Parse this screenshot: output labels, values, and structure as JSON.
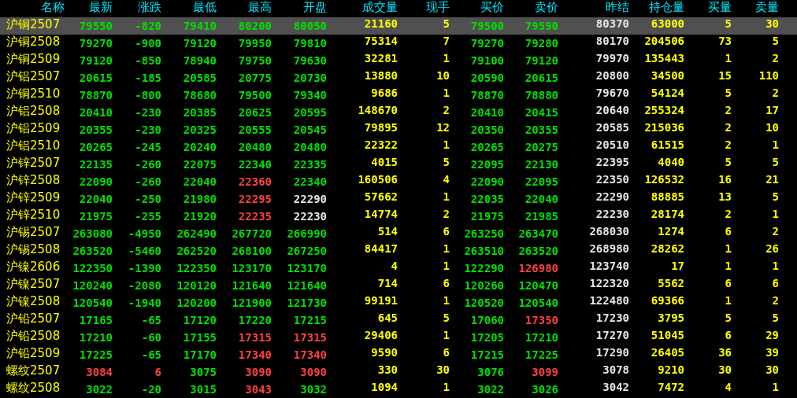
{
  "table": {
    "columns": [
      {
        "label": "名称",
        "kind": "name"
      },
      {
        "label": "最新",
        "kind": "price"
      },
      {
        "label": "涨跌",
        "kind": "price"
      },
      {
        "label": "最低",
        "kind": "price"
      },
      {
        "label": "最高",
        "kind": "price"
      },
      {
        "label": "开盘",
        "kind": "price"
      },
      {
        "label": "成交量",
        "kind": "volume"
      },
      {
        "label": "现手",
        "kind": "volume"
      },
      {
        "label": "买价",
        "kind": "price"
      },
      {
        "label": "卖价",
        "kind": "price"
      },
      {
        "label": "昨结",
        "kind": "settle"
      },
      {
        "label": "持仓量",
        "kind": "volume"
      },
      {
        "label": "买量",
        "kind": "volume"
      },
      {
        "label": "卖量",
        "kind": "volume"
      }
    ],
    "rows": [
      {
        "selected": true,
        "cells": [
          "沪铜2507",
          {
            "text": "79550",
            "color": "#00e000"
          },
          {
            "text": "-820",
            "color": "#00e000"
          },
          {
            "text": "79410",
            "color": "#00e000"
          },
          {
            "text": "80200",
            "color": "#00e000"
          },
          {
            "text": "80050",
            "color": "#00e000"
          },
          "21160",
          "5",
          {
            "text": "79500",
            "color": "#00e000"
          },
          {
            "text": "79590",
            "color": "#00e000"
          },
          "80370",
          "63000",
          "5",
          "30"
        ]
      },
      {
        "selected": false,
        "cells": [
          "沪铜2508",
          {
            "text": "79270",
            "color": "#00e000"
          },
          {
            "text": "-900",
            "color": "#00e000"
          },
          {
            "text": "79120",
            "color": "#00e000"
          },
          {
            "text": "79950",
            "color": "#00e000"
          },
          {
            "text": "79810",
            "color": "#00e000"
          },
          "75314",
          "7",
          {
            "text": "79270",
            "color": "#00e000"
          },
          {
            "text": "79280",
            "color": "#00e000"
          },
          "80170",
          "204506",
          "73",
          "5"
        ]
      },
      {
        "selected": false,
        "cells": [
          "沪铜2509",
          {
            "text": "79120",
            "color": "#00e000"
          },
          {
            "text": "-850",
            "color": "#00e000"
          },
          {
            "text": "78940",
            "color": "#00e000"
          },
          {
            "text": "79750",
            "color": "#00e000"
          },
          {
            "text": "79630",
            "color": "#00e000"
          },
          "32281",
          "1",
          {
            "text": "79100",
            "color": "#00e000"
          },
          {
            "text": "79120",
            "color": "#00e000"
          },
          "79970",
          "135443",
          "1",
          "2"
        ]
      },
      {
        "selected": false,
        "cells": [
          "沪铝2507",
          {
            "text": "20615",
            "color": "#00e000"
          },
          {
            "text": "-185",
            "color": "#00e000"
          },
          {
            "text": "20585",
            "color": "#00e000"
          },
          {
            "text": "20775",
            "color": "#00e000"
          },
          {
            "text": "20730",
            "color": "#00e000"
          },
          "13880",
          "10",
          {
            "text": "20590",
            "color": "#00e000"
          },
          {
            "text": "20615",
            "color": "#00e000"
          },
          "20800",
          "34500",
          "15",
          "110"
        ]
      },
      {
        "selected": false,
        "cells": [
          "沪铜2510",
          {
            "text": "78870",
            "color": "#00e000"
          },
          {
            "text": "-800",
            "color": "#00e000"
          },
          {
            "text": "78680",
            "color": "#00e000"
          },
          {
            "text": "79500",
            "color": "#00e000"
          },
          {
            "text": "79340",
            "color": "#00e000"
          },
          "9686",
          "1",
          {
            "text": "78870",
            "color": "#00e000"
          },
          {
            "text": "78880",
            "color": "#00e000"
          },
          "79670",
          "54124",
          "5",
          "2"
        ]
      },
      {
        "selected": false,
        "cells": [
          "沪铝2508",
          {
            "text": "20410",
            "color": "#00e000"
          },
          {
            "text": "-230",
            "color": "#00e000"
          },
          {
            "text": "20385",
            "color": "#00e000"
          },
          {
            "text": "20625",
            "color": "#00e000"
          },
          {
            "text": "20595",
            "color": "#00e000"
          },
          "148670",
          "2",
          {
            "text": "20410",
            "color": "#00e000"
          },
          {
            "text": "20415",
            "color": "#00e000"
          },
          "20640",
          "255324",
          "2",
          "17"
        ]
      },
      {
        "selected": false,
        "cells": [
          "沪铝2509",
          {
            "text": "20355",
            "color": "#00e000"
          },
          {
            "text": "-230",
            "color": "#00e000"
          },
          {
            "text": "20325",
            "color": "#00e000"
          },
          {
            "text": "20555",
            "color": "#00e000"
          },
          {
            "text": "20545",
            "color": "#00e000"
          },
          "79895",
          "12",
          {
            "text": "20350",
            "color": "#00e000"
          },
          {
            "text": "20355",
            "color": "#00e000"
          },
          "20585",
          "215036",
          "2",
          "10"
        ]
      },
      {
        "selected": false,
        "cells": [
          "沪铝2510",
          {
            "text": "20265",
            "color": "#00e000"
          },
          {
            "text": "-245",
            "color": "#00e000"
          },
          {
            "text": "20240",
            "color": "#00e000"
          },
          {
            "text": "20480",
            "color": "#00e000"
          },
          {
            "text": "20480",
            "color": "#00e000"
          },
          "22322",
          "1",
          {
            "text": "20265",
            "color": "#00e000"
          },
          {
            "text": "20275",
            "color": "#00e000"
          },
          "20510",
          "61515",
          "2",
          "1"
        ]
      },
      {
        "selected": false,
        "cells": [
          "沪锌2507",
          {
            "text": "22135",
            "color": "#00e000"
          },
          {
            "text": "-260",
            "color": "#00e000"
          },
          {
            "text": "22075",
            "color": "#00e000"
          },
          {
            "text": "22340",
            "color": "#00e000"
          },
          {
            "text": "22335",
            "color": "#00e000"
          },
          "4015",
          "5",
          {
            "text": "22095",
            "color": "#00e000"
          },
          {
            "text": "22130",
            "color": "#00e000"
          },
          "22395",
          "4040",
          "5",
          "5"
        ]
      },
      {
        "selected": false,
        "cells": [
          "沪锌2508",
          {
            "text": "22090",
            "color": "#00e000"
          },
          {
            "text": "-260",
            "color": "#00e000"
          },
          {
            "text": "22040",
            "color": "#00e000"
          },
          {
            "text": "22360",
            "color": "#ff4040"
          },
          {
            "text": "22340",
            "color": "#00e000"
          },
          "160506",
          "4",
          {
            "text": "22090",
            "color": "#00e000"
          },
          {
            "text": "22095",
            "color": "#00e000"
          },
          "22350",
          "126532",
          "16",
          "21"
        ]
      },
      {
        "selected": false,
        "cells": [
          "沪锌2509",
          {
            "text": "22040",
            "color": "#00e000"
          },
          {
            "text": "-250",
            "color": "#00e000"
          },
          {
            "text": "21980",
            "color": "#00e000"
          },
          {
            "text": "22295",
            "color": "#ff4040"
          },
          {
            "text": "22290",
            "color": "#e6e6e6"
          },
          "57662",
          "1",
          {
            "text": "22035",
            "color": "#00e000"
          },
          {
            "text": "22040",
            "color": "#00e000"
          },
          "22290",
          "88885",
          "13",
          "5"
        ]
      },
      {
        "selected": false,
        "cells": [
          "沪锌2510",
          {
            "text": "21975",
            "color": "#00e000"
          },
          {
            "text": "-255",
            "color": "#00e000"
          },
          {
            "text": "21920",
            "color": "#00e000"
          },
          {
            "text": "22235",
            "color": "#ff4040"
          },
          {
            "text": "22230",
            "color": "#e6e6e6"
          },
          "14774",
          "2",
          {
            "text": "21975",
            "color": "#00e000"
          },
          {
            "text": "21985",
            "color": "#00e000"
          },
          "22230",
          "28174",
          "2",
          "1"
        ]
      },
      {
        "selected": false,
        "cells": [
          "沪锡2507",
          {
            "text": "263080",
            "color": "#00e000"
          },
          {
            "text": "-4950",
            "color": "#00e000"
          },
          {
            "text": "262490",
            "color": "#00e000"
          },
          {
            "text": "267720",
            "color": "#00e000"
          },
          {
            "text": "266990",
            "color": "#00e000"
          },
          "514",
          "6",
          {
            "text": "263250",
            "color": "#00e000"
          },
          {
            "text": "263470",
            "color": "#00e000"
          },
          "268030",
          "1274",
          "6",
          "2"
        ]
      },
      {
        "selected": false,
        "cells": [
          "沪锡2508",
          {
            "text": "263520",
            "color": "#00e000"
          },
          {
            "text": "-5460",
            "color": "#00e000"
          },
          {
            "text": "262520",
            "color": "#00e000"
          },
          {
            "text": "268100",
            "color": "#00e000"
          },
          {
            "text": "267250",
            "color": "#00e000"
          },
          "84417",
          "1",
          {
            "text": "263510",
            "color": "#00e000"
          },
          {
            "text": "263520",
            "color": "#00e000"
          },
          "268980",
          "28262",
          "1",
          "26"
        ]
      },
      {
        "selected": false,
        "cells": [
          "沪镍2606",
          {
            "text": "122350",
            "color": "#00e000"
          },
          {
            "text": "-1390",
            "color": "#00e000"
          },
          {
            "text": "122350",
            "color": "#00e000"
          },
          {
            "text": "123170",
            "color": "#00e000"
          },
          {
            "text": "123170",
            "color": "#00e000"
          },
          "4",
          "1",
          {
            "text": "122290",
            "color": "#00e000"
          },
          {
            "text": "126980",
            "color": "#ff4040"
          },
          "123740",
          "17",
          "1",
          "1"
        ]
      },
      {
        "selected": false,
        "cells": [
          "沪镍2507",
          {
            "text": "120240",
            "color": "#00e000"
          },
          {
            "text": "-2080",
            "color": "#00e000"
          },
          {
            "text": "120120",
            "color": "#00e000"
          },
          {
            "text": "121640",
            "color": "#00e000"
          },
          {
            "text": "121640",
            "color": "#00e000"
          },
          "714",
          "6",
          {
            "text": "120260",
            "color": "#00e000"
          },
          {
            "text": "120470",
            "color": "#00e000"
          },
          "122320",
          "5562",
          "6",
          "6"
        ]
      },
      {
        "selected": false,
        "cells": [
          "沪镍2508",
          {
            "text": "120540",
            "color": "#00e000"
          },
          {
            "text": "-1940",
            "color": "#00e000"
          },
          {
            "text": "120200",
            "color": "#00e000"
          },
          {
            "text": "121900",
            "color": "#00e000"
          },
          {
            "text": "121730",
            "color": "#00e000"
          },
          "99191",
          "1",
          {
            "text": "120520",
            "color": "#00e000"
          },
          {
            "text": "120540",
            "color": "#00e000"
          },
          "122480",
          "69366",
          "1",
          "2"
        ]
      },
      {
        "selected": false,
        "cells": [
          "沪铅2507",
          {
            "text": "17165",
            "color": "#00e000"
          },
          {
            "text": "-65",
            "color": "#00e000"
          },
          {
            "text": "17120",
            "color": "#00e000"
          },
          {
            "text": "17220",
            "color": "#00e000"
          },
          {
            "text": "17215",
            "color": "#00e000"
          },
          "645",
          "5",
          {
            "text": "17060",
            "color": "#00e000"
          },
          {
            "text": "17350",
            "color": "#ff4040"
          },
          "17230",
          "3795",
          "5",
          "5"
        ]
      },
      {
        "selected": false,
        "cells": [
          "沪铅2508",
          {
            "text": "17210",
            "color": "#00e000"
          },
          {
            "text": "-60",
            "color": "#00e000"
          },
          {
            "text": "17155",
            "color": "#00e000"
          },
          {
            "text": "17315",
            "color": "#ff4040"
          },
          {
            "text": "17315",
            "color": "#ff4040"
          },
          "29406",
          "1",
          {
            "text": "17205",
            "color": "#00e000"
          },
          {
            "text": "17210",
            "color": "#00e000"
          },
          "17270",
          "51045",
          "6",
          "29"
        ]
      },
      {
        "selected": false,
        "cells": [
          "沪铅2509",
          {
            "text": "17225",
            "color": "#00e000"
          },
          {
            "text": "-65",
            "color": "#00e000"
          },
          {
            "text": "17170",
            "color": "#00e000"
          },
          {
            "text": "17340",
            "color": "#ff4040"
          },
          {
            "text": "17340",
            "color": "#ff4040"
          },
          "9590",
          "6",
          {
            "text": "17215",
            "color": "#00e000"
          },
          {
            "text": "17225",
            "color": "#00e000"
          },
          "17290",
          "26405",
          "36",
          "39"
        ]
      },
      {
        "selected": false,
        "cells": [
          "螺纹2507",
          {
            "text": "3084",
            "color": "#ff4040"
          },
          {
            "text": "6",
            "color": "#ff4040"
          },
          {
            "text": "3075",
            "color": "#00e000"
          },
          {
            "text": "3090",
            "color": "#ff4040"
          },
          {
            "text": "3090",
            "color": "#ff4040"
          },
          "330",
          "30",
          {
            "text": "3076",
            "color": "#00e000"
          },
          {
            "text": "3099",
            "color": "#ff4040"
          },
          "3078",
          "9210",
          "30",
          "30"
        ]
      },
      {
        "selected": false,
        "cells": [
          "螺纹2508",
          {
            "text": "3022",
            "color": "#00e000"
          },
          {
            "text": "-20",
            "color": "#00e000"
          },
          {
            "text": "3015",
            "color": "#00e000"
          },
          {
            "text": "3043",
            "color": "#ff4040"
          },
          {
            "text": "3032",
            "color": "#00e000"
          },
          "1094",
          "1",
          {
            "text": "3022",
            "color": "#00e000"
          },
          {
            "text": "3026",
            "color": "#00e000"
          },
          "3042",
          "7472",
          "4",
          "1"
        ]
      }
    ]
  }
}
